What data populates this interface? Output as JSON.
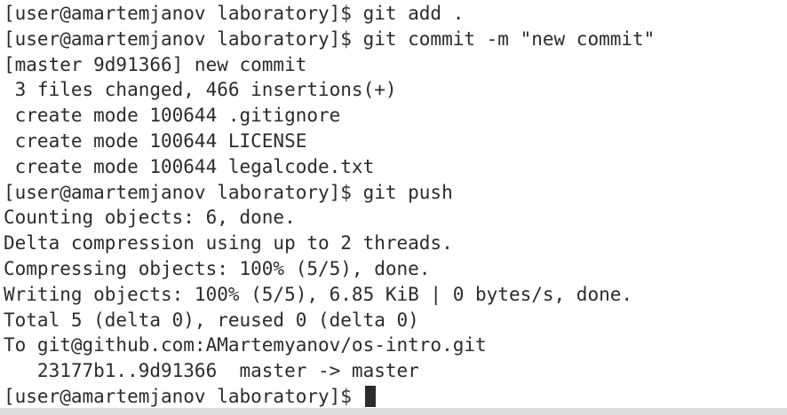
{
  "terminal": {
    "lines": [
      "[user@amartemjanov laboratory]$ git add .",
      "[user@amartemjanov laboratory]$ git commit -m \"new commit\"",
      "[master 9d91366] new commit",
      " 3 files changed, 466 insertions(+)",
      " create mode 100644 .gitignore",
      " create mode 100644 LICENSE",
      " create mode 100644 legalcode.txt",
      "[user@amartemjanov laboratory]$ git push",
      "Counting objects: 6, done.",
      "Delta compression using up to 2 threads.",
      "Compressing objects: 100% (5/5), done.",
      "Writing objects: 100% (5/5), 6.85 KiB | 0 bytes/s, done.",
      "Total 5 (delta 0), reused 0 (delta 0)",
      "To git@github.com:AMartemyanov/os-intro.git",
      "   23177b1..9d91366  master -> master"
    ],
    "prompt": "[user@amartemjanov laboratory]$ "
  },
  "colors": {
    "background": "#ffffff",
    "text": "#2b2b2b"
  }
}
